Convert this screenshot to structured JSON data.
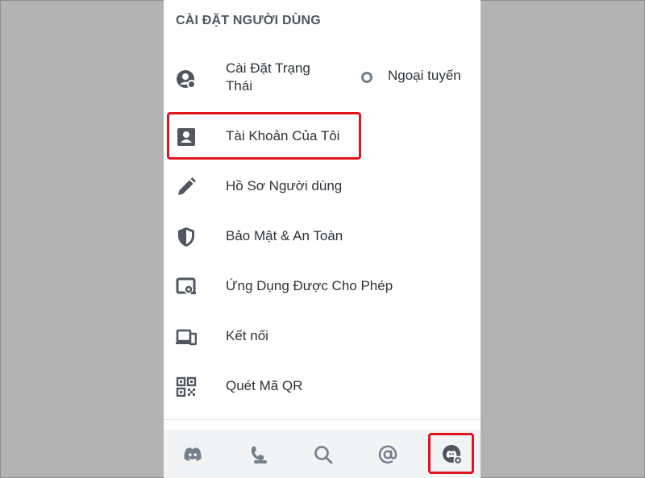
{
  "section_title": "CÀI ĐẶT NGƯỜI DÙNG",
  "colors": {
    "icon": "#4f5660",
    "text": "#2e3338",
    "highlight": "#e0141e",
    "tab_icon": "#747f8d",
    "page_bg": "#b3b3b3"
  },
  "settings": {
    "status_settings": {
      "label": "Cài Đặt Trạng Thái",
      "icon": "user-status-icon",
      "status_value": "Ngoại tuyến"
    },
    "my_account": {
      "label": "Tài Khoản Của Tôi",
      "icon": "account-card-icon"
    },
    "user_profile": {
      "label": "Hồ Sơ Người dùng",
      "icon": "pencil-icon"
    },
    "privacy_safety": {
      "label": "Bảo Mật & An Toàn",
      "icon": "shield-icon"
    },
    "authorized_apps": {
      "label": "Ứng Dụng Được Cho Phép",
      "icon": "authorized-apps-icon"
    },
    "connections": {
      "label": "Kết nối",
      "icon": "devices-icon"
    },
    "scan_qr": {
      "label": "Quét Mã QR",
      "icon": "qr-code-icon"
    }
  },
  "tabbar": {
    "items": [
      {
        "icon": "discord-home-icon"
      },
      {
        "icon": "friends-icon"
      },
      {
        "icon": "search-icon"
      },
      {
        "icon": "mentions-icon"
      },
      {
        "icon": "user-avatar-icon",
        "highlighted": true
      }
    ]
  }
}
